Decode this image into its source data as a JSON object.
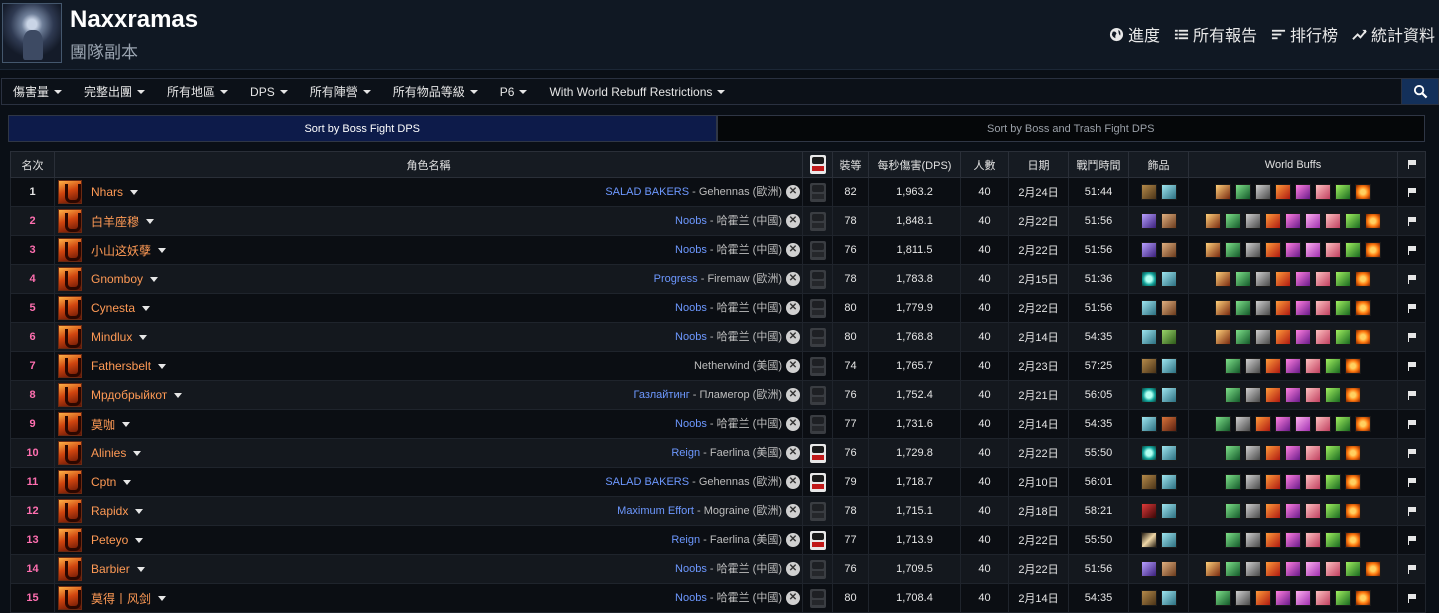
{
  "header": {
    "title": "Naxxramas",
    "subtitle": "團隊副本",
    "nav": [
      "進度",
      "所有報告",
      "排行榜",
      "統計資料"
    ]
  },
  "filters": [
    "傷害量",
    "完整出團",
    "所有地區",
    "DPS",
    "所有陣營",
    "所有物品等級",
    "P6",
    "With World Rebuff Restrictions"
  ],
  "sort_tabs": {
    "active": "Sort by Boss Fight DPS",
    "inactive": "Sort by Boss and Trash Fight DPS"
  },
  "table": {
    "headers": {
      "rank": "名次",
      "name": "角色名稱",
      "ilvl": "裝等",
      "dps": "每秒傷害(DPS)",
      "players": "人數",
      "date": "日期",
      "duration": "戰鬥時間",
      "trinkets": "飾品",
      "buffs": "World Buffs"
    },
    "rows": [
      {
        "rank": "1",
        "name": "Nhars",
        "guild": "SALAD BAKERS",
        "server": " - Gehennas (歐洲)",
        "video": false,
        "ilvl": "82",
        "dps": "1,963.2",
        "players": "40",
        "date": "2月24日",
        "duration": "51:44",
        "trinkets": [
          "brown",
          "teal"
        ],
        "buffs": [
          "orange1",
          "green",
          "gray",
          "fire",
          "magenta",
          "pink",
          "greenwing",
          "orb"
        ]
      },
      {
        "rank": "2",
        "name": "白羊座穆",
        "guild": "Noobs",
        "server": " - 哈霍兰 (中國)",
        "video": false,
        "ilvl": "78",
        "dps": "1,848.1",
        "players": "40",
        "date": "2月22日",
        "duration": "51:56",
        "trinkets": [
          "purple",
          "skin"
        ],
        "buffs": [
          "orange1",
          "green",
          "gray",
          "fire",
          "magenta",
          "pinkfeather",
          "pink",
          "greenwing",
          "orb"
        ]
      },
      {
        "rank": "3",
        "name": "小山这妖孽",
        "guild": "Noobs",
        "server": " - 哈霍兰 (中國)",
        "video": false,
        "ilvl": "76",
        "dps": "1,811.5",
        "players": "40",
        "date": "2月22日",
        "duration": "51:56",
        "trinkets": [
          "purple",
          "skin"
        ],
        "buffs": [
          "orange1",
          "green",
          "gray",
          "fire",
          "magenta",
          "pinkfeather",
          "pink",
          "greenwing",
          "orb"
        ]
      },
      {
        "rank": "4",
        "name": "Gnomboy",
        "guild": "Progress",
        "server": " - Firemaw (歐洲)",
        "video": false,
        "ilvl": "78",
        "dps": "1,783.8",
        "players": "40",
        "date": "2月15日",
        "duration": "51:36",
        "trinkets": [
          "cyan",
          "teal"
        ],
        "buffs": [
          "orange1",
          "green",
          "gray",
          "fire",
          "magenta",
          "pink",
          "greenwing",
          "orb"
        ]
      },
      {
        "rank": "5",
        "name": "Cynesta",
        "guild": "Noobs",
        "server": " - 哈霍兰 (中國)",
        "video": false,
        "ilvl": "80",
        "dps": "1,779.9",
        "players": "40",
        "date": "2月22日",
        "duration": "51:56",
        "trinkets": [
          "teal",
          "skin"
        ],
        "buffs": [
          "orange1",
          "green",
          "gray",
          "fire",
          "magenta",
          "pink",
          "greenwing",
          "orb"
        ]
      },
      {
        "rank": "6",
        "name": "Mindlux",
        "guild": "Noobs",
        "server": " - 哈霍兰 (中國)",
        "video": false,
        "ilvl": "80",
        "dps": "1,768.8",
        "players": "40",
        "date": "2月14日",
        "duration": "54:35",
        "trinkets": [
          "teal",
          "moss"
        ],
        "buffs": [
          "orange1",
          "green",
          "gray",
          "fire",
          "magenta",
          "pink",
          "greenwing",
          "orb"
        ]
      },
      {
        "rank": "7",
        "name": "Fathersbelt",
        "guild": "",
        "server": "Netherwind (美國)",
        "video": false,
        "ilvl": "74",
        "dps": "1,765.7",
        "players": "40",
        "date": "2月23日",
        "duration": "57:25",
        "trinkets": [
          "brown",
          "teal"
        ],
        "buffs": [
          "green",
          "gray",
          "fire",
          "magenta",
          "pink",
          "greenwing",
          "orb"
        ]
      },
      {
        "rank": "8",
        "name": "Мрдобрыйкот",
        "guild": "Газлайтинг",
        "server": " - Пламегор (歐洲)",
        "video": false,
        "ilvl": "76",
        "dps": "1,752.4",
        "players": "40",
        "date": "2月21日",
        "duration": "56:05",
        "trinkets": [
          "cyan",
          "teal"
        ],
        "buffs": [
          "green",
          "gray",
          "fire",
          "magenta",
          "pink",
          "greenwing",
          "orb"
        ]
      },
      {
        "rank": "9",
        "name": "莫咖",
        "guild": "Noobs",
        "server": " - 哈霍兰 (中國)",
        "video": false,
        "ilvl": "77",
        "dps": "1,731.6",
        "players": "40",
        "date": "2月14日",
        "duration": "54:35",
        "trinkets": [
          "teal",
          "rust"
        ],
        "buffs": [
          "green",
          "gray",
          "fire",
          "magenta",
          "pinkfeather",
          "pink",
          "greenwing",
          "orb"
        ]
      },
      {
        "rank": "10",
        "name": "Alinies",
        "guild": "Reign",
        "server": " - Faerlina (美國)",
        "video": true,
        "ilvl": "76",
        "dps": "1,729.8",
        "players": "40",
        "date": "2月22日",
        "duration": "55:50",
        "trinkets": [
          "cyan",
          "teal"
        ],
        "buffs": [
          "green",
          "gray",
          "fire",
          "magenta",
          "pink",
          "greenwing",
          "orb"
        ]
      },
      {
        "rank": "11",
        "name": "Cptn",
        "guild": "SALAD BAKERS",
        "server": " - Gehennas (歐洲)",
        "video": true,
        "ilvl": "79",
        "dps": "1,718.7",
        "players": "40",
        "date": "2月10日",
        "duration": "56:01",
        "trinkets": [
          "brown",
          "teal"
        ],
        "buffs": [
          "green",
          "gray",
          "fire",
          "magenta",
          "pink",
          "greenwing",
          "orb"
        ]
      },
      {
        "rank": "12",
        "name": "Rapidx",
        "guild": "Maximum Effort",
        "server": " - Mograine (歐洲)",
        "video": false,
        "ilvl": "78",
        "dps": "1,715.1",
        "players": "40",
        "date": "2月18日",
        "duration": "58:21",
        "trinkets": [
          "red",
          "teal"
        ],
        "buffs": [
          "green",
          "gray",
          "fire",
          "magenta",
          "pink",
          "greenwing",
          "orb"
        ]
      },
      {
        "rank": "13",
        "name": "Peteyo",
        "guild": "Reign",
        "server": " - Faerlina (美國)",
        "video": true,
        "ilvl": "77",
        "dps": "1,713.9",
        "players": "40",
        "date": "2月22日",
        "duration": "55:50",
        "trinkets": [
          "bow",
          "teal"
        ],
        "buffs": [
          "green",
          "gray",
          "fire",
          "magenta",
          "pink",
          "greenwing",
          "orb"
        ]
      },
      {
        "rank": "14",
        "name": "Barbier",
        "guild": "Noobs",
        "server": " - 哈霍兰 (中國)",
        "video": false,
        "ilvl": "76",
        "dps": "1,709.5",
        "players": "40",
        "date": "2月22日",
        "duration": "51:56",
        "trinkets": [
          "purple",
          "skin"
        ],
        "buffs": [
          "orange1",
          "green",
          "gray",
          "fire",
          "magenta",
          "pinkfeather",
          "pink",
          "greenwing",
          "orb"
        ]
      },
      {
        "rank": "15",
        "name": "莫得丨风剑",
        "guild": "Noobs",
        "server": " - 哈霍兰 (中國)",
        "video": false,
        "ilvl": "80",
        "dps": "1,708.4",
        "players": "40",
        "date": "2月14日",
        "duration": "54:35",
        "trinkets": [
          "brown",
          "teal"
        ],
        "buffs": [
          "green",
          "gray",
          "fire",
          "magenta",
          "pinkfeather",
          "pink",
          "greenwing",
          "orb"
        ]
      }
    ]
  }
}
